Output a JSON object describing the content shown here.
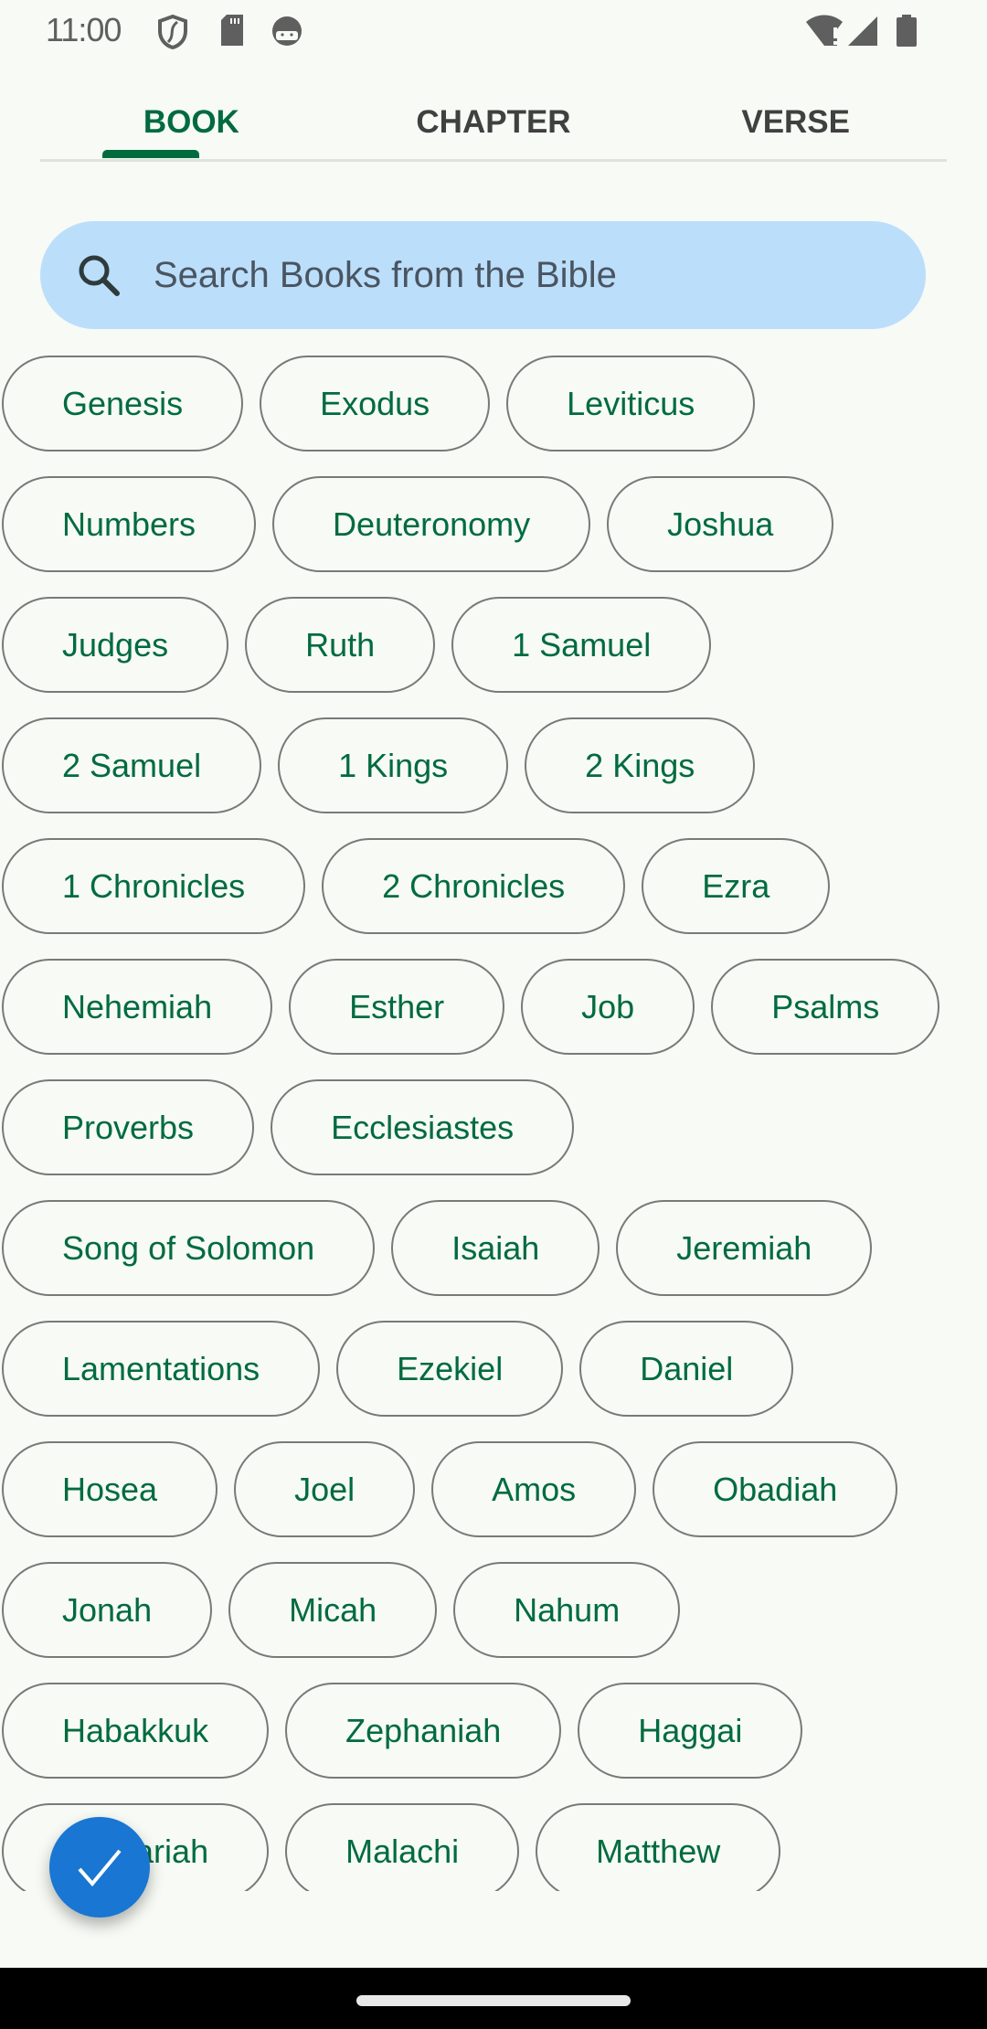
{
  "status_bar": {
    "time": "11:00",
    "left_icons": [
      "shield-icon",
      "sd-card-icon",
      "android-face-icon"
    ],
    "right_icons": [
      "wifi-alert-icon",
      "cellular-signal-icon",
      "battery-icon"
    ]
  },
  "tabs": [
    {
      "label": "BOOK",
      "active": true
    },
    {
      "label": "CHAPTER",
      "active": false
    },
    {
      "label": "VERSE",
      "active": false
    }
  ],
  "search": {
    "placeholder": "Search Books from the Bible",
    "value": "",
    "icon": "search-icon"
  },
  "books": [
    [
      "Genesis",
      "Exodus",
      "Leviticus"
    ],
    [
      "Numbers",
      "Deuteronomy",
      "Joshua"
    ],
    [
      "Judges",
      "Ruth",
      "1 Samuel"
    ],
    [
      "2 Samuel",
      "1 Kings",
      "2 Kings"
    ],
    [
      "1 Chronicles",
      "2 Chronicles",
      "Ezra"
    ],
    [
      "Nehemiah",
      "Esther",
      "Job",
      "Psalms"
    ],
    [
      "Proverbs",
      "Ecclesiastes"
    ],
    [
      "Song of Solomon",
      "Isaiah",
      "Jeremiah"
    ],
    [
      "Lamentations",
      "Ezekiel",
      "Daniel"
    ],
    [
      "Hosea",
      "Joel",
      "Amos",
      "Obadiah"
    ],
    [
      "Jonah",
      "Micah",
      "Nahum"
    ],
    [
      "Habakkuk",
      "Zephaniah",
      "Haggai"
    ],
    [
      "Zechariah",
      "Malachi",
      "Matthew"
    ]
  ],
  "fab": {
    "icon": "check-icon"
  },
  "colors": {
    "accent": "#006b3f",
    "search_bg": "#bbdefb",
    "fab": "#1976d2",
    "background": "#f7faf5"
  }
}
